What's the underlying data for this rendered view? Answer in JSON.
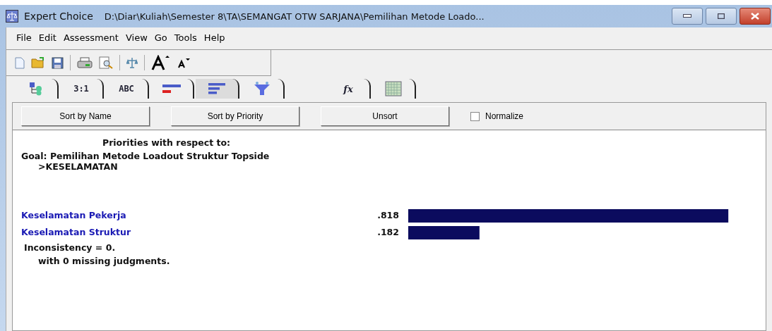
{
  "window": {
    "app_name": "Expert Choice",
    "title": "D:\\Diar\\Kuliah\\Semester 8\\TA\\SEMANGAT OTW SARJANA\\Pemilihan Metode Loado..."
  },
  "menu": [
    "File",
    "Edit",
    "Assessment",
    "View",
    "Go",
    "Tools",
    "Help"
  ],
  "tabs": [
    {
      "kind": "tree",
      "selected": false
    },
    {
      "kind": "text",
      "label": "3:1",
      "selected": false
    },
    {
      "kind": "text",
      "label": "ABC",
      "selected": false
    },
    {
      "kind": "bars-mixed",
      "selected": false
    },
    {
      "kind": "bars",
      "selected": true
    },
    {
      "kind": "funnel",
      "selected": false
    },
    {
      "kind": "fx",
      "label": "fx",
      "selected": false
    },
    {
      "kind": "grid",
      "selected": false
    }
  ],
  "buttons": [
    "Sort by Name",
    "Sort by Priority",
    "Unsort"
  ],
  "normalize": {
    "label": "Normalize",
    "checked": false
  },
  "report": {
    "heading": "Priorities with respect to:",
    "goal": "Goal: Pemilihan Metode Loadout Struktur Topside",
    "node": ">KESELAMATAN",
    "chart_data": {
      "type": "bar",
      "orientation": "horizontal",
      "categories": [
        "Keselamatan Pekerja",
        "Keselamatan Struktur"
      ],
      "values": [
        0.818,
        0.182
      ],
      "value_labels": [
        ".818",
        ".182"
      ]
    },
    "inconsistency": "Inconsistency = 0.",
    "missing": "with 0  missing judgments."
  }
}
